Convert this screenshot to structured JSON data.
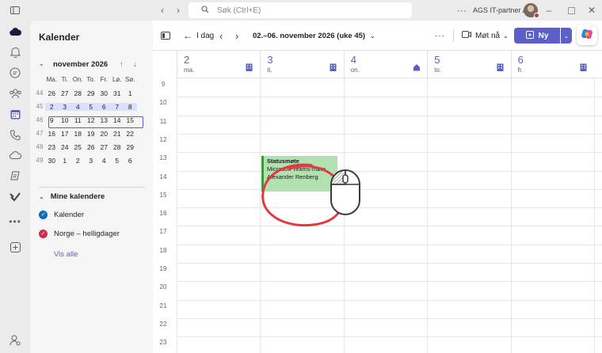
{
  "titlebar": {
    "search_placeholder": "Søk (Ctrl+E)",
    "org_name": "AGS IT-partner AS",
    "icons": [
      "sidebar-toggle-icon",
      "back-icon",
      "forward-icon",
      "search-icon",
      "more-icon",
      "minimize-icon",
      "maximize-icon",
      "close-icon"
    ]
  },
  "rail": {
    "items": [
      "cloud-icon",
      "bell-icon",
      "chat-icon",
      "teams-icon",
      "calendar-icon",
      "phone-icon",
      "onedrive-icon",
      "sharepoint-icon",
      "planner-icon",
      "more-apps-icon",
      "add-apps-icon",
      "admin-icon"
    ],
    "active": "calendar-icon"
  },
  "sidebar": {
    "title": "Kalender",
    "mini_calendar": {
      "month_label": "november 2026",
      "weekday_headers": [
        "Ma.",
        "Ti.",
        "On.",
        "To.",
        "Fr.",
        "Lø.",
        "Sø."
      ],
      "weeks": [
        {
          "week": "44",
          "days": [
            "26",
            "27",
            "28",
            "29",
            "30",
            "31",
            "1"
          ]
        },
        {
          "week": "45",
          "days": [
            "2",
            "3",
            "4",
            "5",
            "6",
            "7",
            "8"
          ]
        },
        {
          "week": "46",
          "days": [
            "9",
            "10",
            "11",
            "12",
            "13",
            "14",
            "15"
          ]
        },
        {
          "week": "47",
          "days": [
            "16",
            "17",
            "18",
            "19",
            "20",
            "21",
            "22"
          ]
        },
        {
          "week": "48",
          "days": [
            "23",
            "24",
            "25",
            "26",
            "27",
            "28",
            "29"
          ]
        },
        {
          "week": "49",
          "days": [
            "30",
            "1",
            "2",
            "3",
            "4",
            "5",
            "6"
          ]
        }
      ],
      "selected_week_index": 1
    },
    "my_calendars_label": "Mine kalendere",
    "calendars": [
      {
        "name": "Kalender",
        "color": "#0f6cbd"
      },
      {
        "name": "Norge – helligdager",
        "color": "#c4314b"
      }
    ],
    "see_all": "Vis alle"
  },
  "toolbar": {
    "today_label": "I dag",
    "range_label": "02.–06. november 2026 (uke 45)",
    "meet_now_label": "Møt nå",
    "new_label": "Ny"
  },
  "days": [
    {
      "num": "2",
      "name": "ma.",
      "icon": "office-home-icon"
    },
    {
      "num": "3",
      "name": "ti.",
      "icon": "building-icon"
    },
    {
      "num": "4",
      "name": "on.",
      "icon": "home-icon"
    },
    {
      "num": "5",
      "name": "to.",
      "icon": "building-icon"
    },
    {
      "num": "6",
      "name": "fr.",
      "icon": "building-icon"
    }
  ],
  "hours": [
    "9",
    "10",
    "11",
    "12",
    "13",
    "14",
    "15",
    "16",
    "17",
    "18",
    "19",
    "20",
    "21",
    "22",
    "23"
  ],
  "event": {
    "title": "Statusmøte",
    "subtitle": "Microsoft Teams-møte",
    "organizer": "Alexander Renberg",
    "color": "#b3e0b0",
    "border_color": "#3a9a3a"
  },
  "annotation": {
    "circle_color": "#e0393e"
  },
  "colors": {
    "accent": "#5b5fc7"
  }
}
